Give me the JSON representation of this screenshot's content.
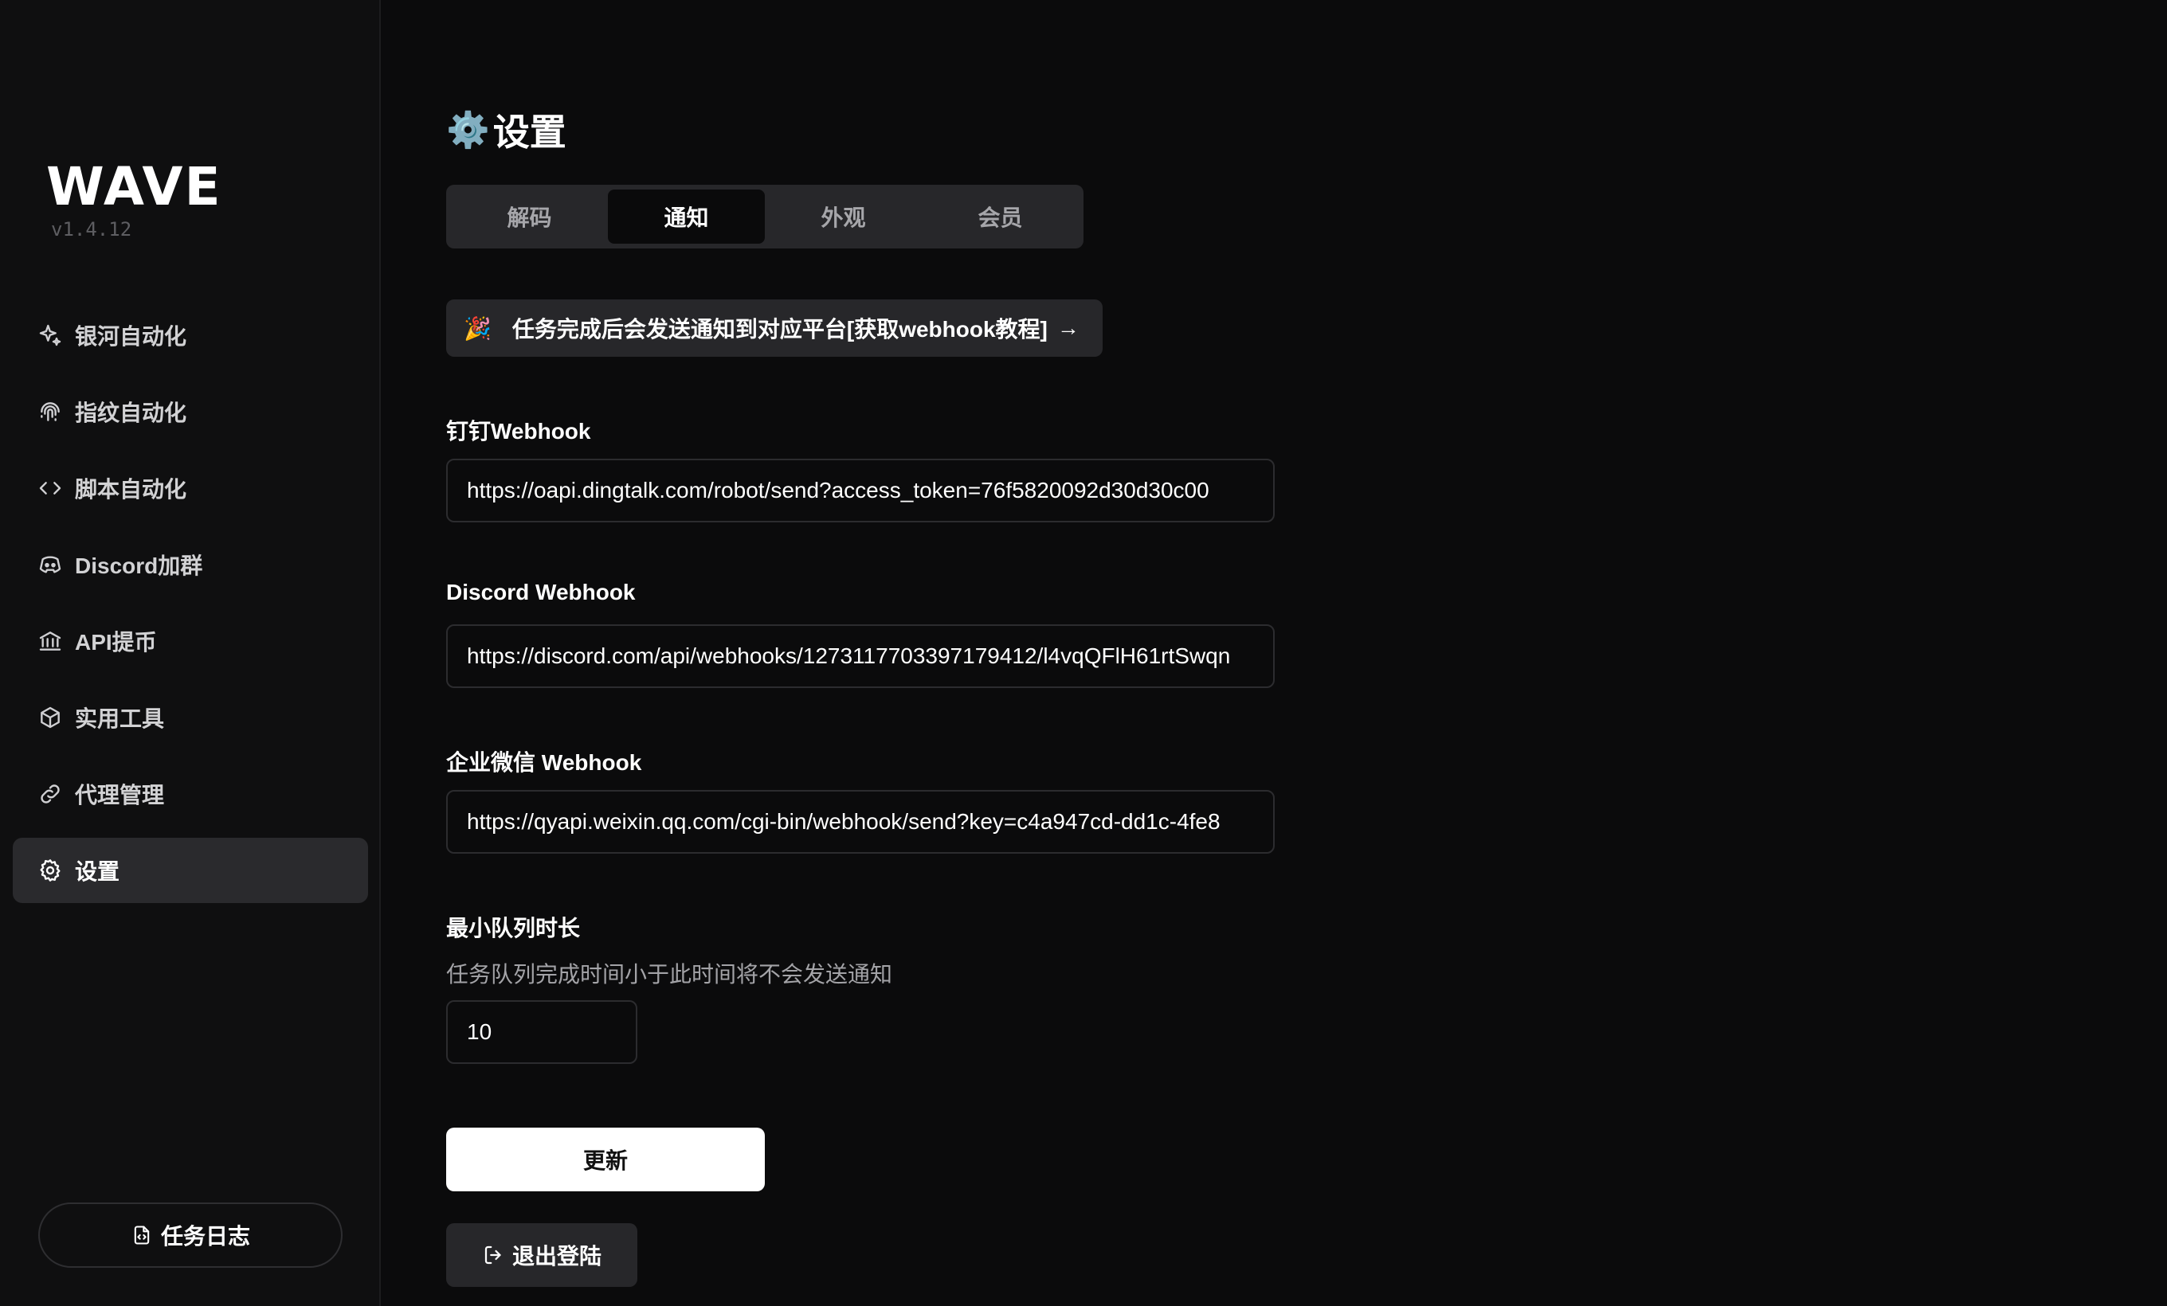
{
  "app": {
    "logo": "WAVE",
    "version": "v1.4.12"
  },
  "sidebar": {
    "items": [
      {
        "label": "银河自动化",
        "icon": "sparkles-icon",
        "active": false
      },
      {
        "label": "指纹自动化",
        "icon": "fingerprint-icon",
        "active": false
      },
      {
        "label": "脚本自动化",
        "icon": "code-icon",
        "active": false
      },
      {
        "label": "Discord加群",
        "icon": "discord-icon",
        "active": false
      },
      {
        "label": "API提币",
        "icon": "bank-icon",
        "active": false
      },
      {
        "label": "实用工具",
        "icon": "package-icon",
        "active": false
      },
      {
        "label": "代理管理",
        "icon": "link-icon",
        "active": false
      },
      {
        "label": "设置",
        "icon": "gear-icon",
        "active": true
      }
    ],
    "task_log_label": "任务日志"
  },
  "page": {
    "title_icon": "⚙️",
    "title": "设置",
    "tabs": [
      {
        "label": "解码",
        "active": false
      },
      {
        "label": "通知",
        "active": true
      },
      {
        "label": "外观",
        "active": false
      },
      {
        "label": "会员",
        "active": false
      }
    ],
    "banner": {
      "emoji": "🎉",
      "text": "任务完成后会发送通知到对应平台[获取webhook教程]",
      "arrow": "→"
    },
    "fields": {
      "dingtalk": {
        "label": "钉钉Webhook",
        "value": "https://oapi.dingtalk.com/robot/send?access_token=76f5820092d30d30c00"
      },
      "discord": {
        "label": "Discord Webhook",
        "value": "https://discord.com/api/webhooks/1273117703397179412/l4vqQFlH61rtSwqn"
      },
      "wecom": {
        "label": "企业微信 Webhook",
        "value": "https://qyapi.weixin.qq.com/cgi-bin/webhook/send?key=c4a947cd-dd1c-4fe8"
      },
      "min_queue": {
        "label": "最小队列时长",
        "hint": "任务队列完成时间小于此时间将不会发送通知",
        "value": "10"
      }
    },
    "update_label": "更新",
    "logout_label": "退出登陆"
  }
}
